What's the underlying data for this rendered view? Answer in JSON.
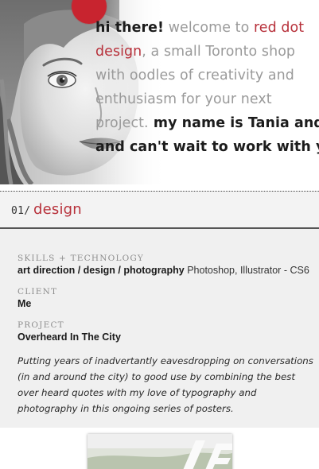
{
  "hero": {
    "greeting": "hi there!",
    "welcome_pre": " welcome to ",
    "brand_line1": "red dot",
    "brand_line2": "design",
    "line2_rest": ", a small Toronto shop",
    "line3": "with oodles of creativity and",
    "line4": "enthusiasm for your next",
    "line5_grey": "project.",
    "line5_dark": " my name is Tania and I",
    "line6": "and can't wait to work with you!",
    "accent_color": "#c8242f"
  },
  "section": {
    "number": "01/",
    "title": "design"
  },
  "details": {
    "skills_label": "SKILLS + TECHNOLOGY",
    "skills_bold": "art direction / design / photography",
    "skills_tools": " Photoshop, Illustrator - CS6",
    "client_label": "CLIENT",
    "client_value": "Me",
    "project_label": "PROJECT",
    "project_value": "Overheard In The City",
    "description": "Putting years of inadvertantly eavesdropping on conversations (in and around the city) to good use by combining the best over heard quotes with my love of typography and photography in this ongoing series of posters."
  }
}
